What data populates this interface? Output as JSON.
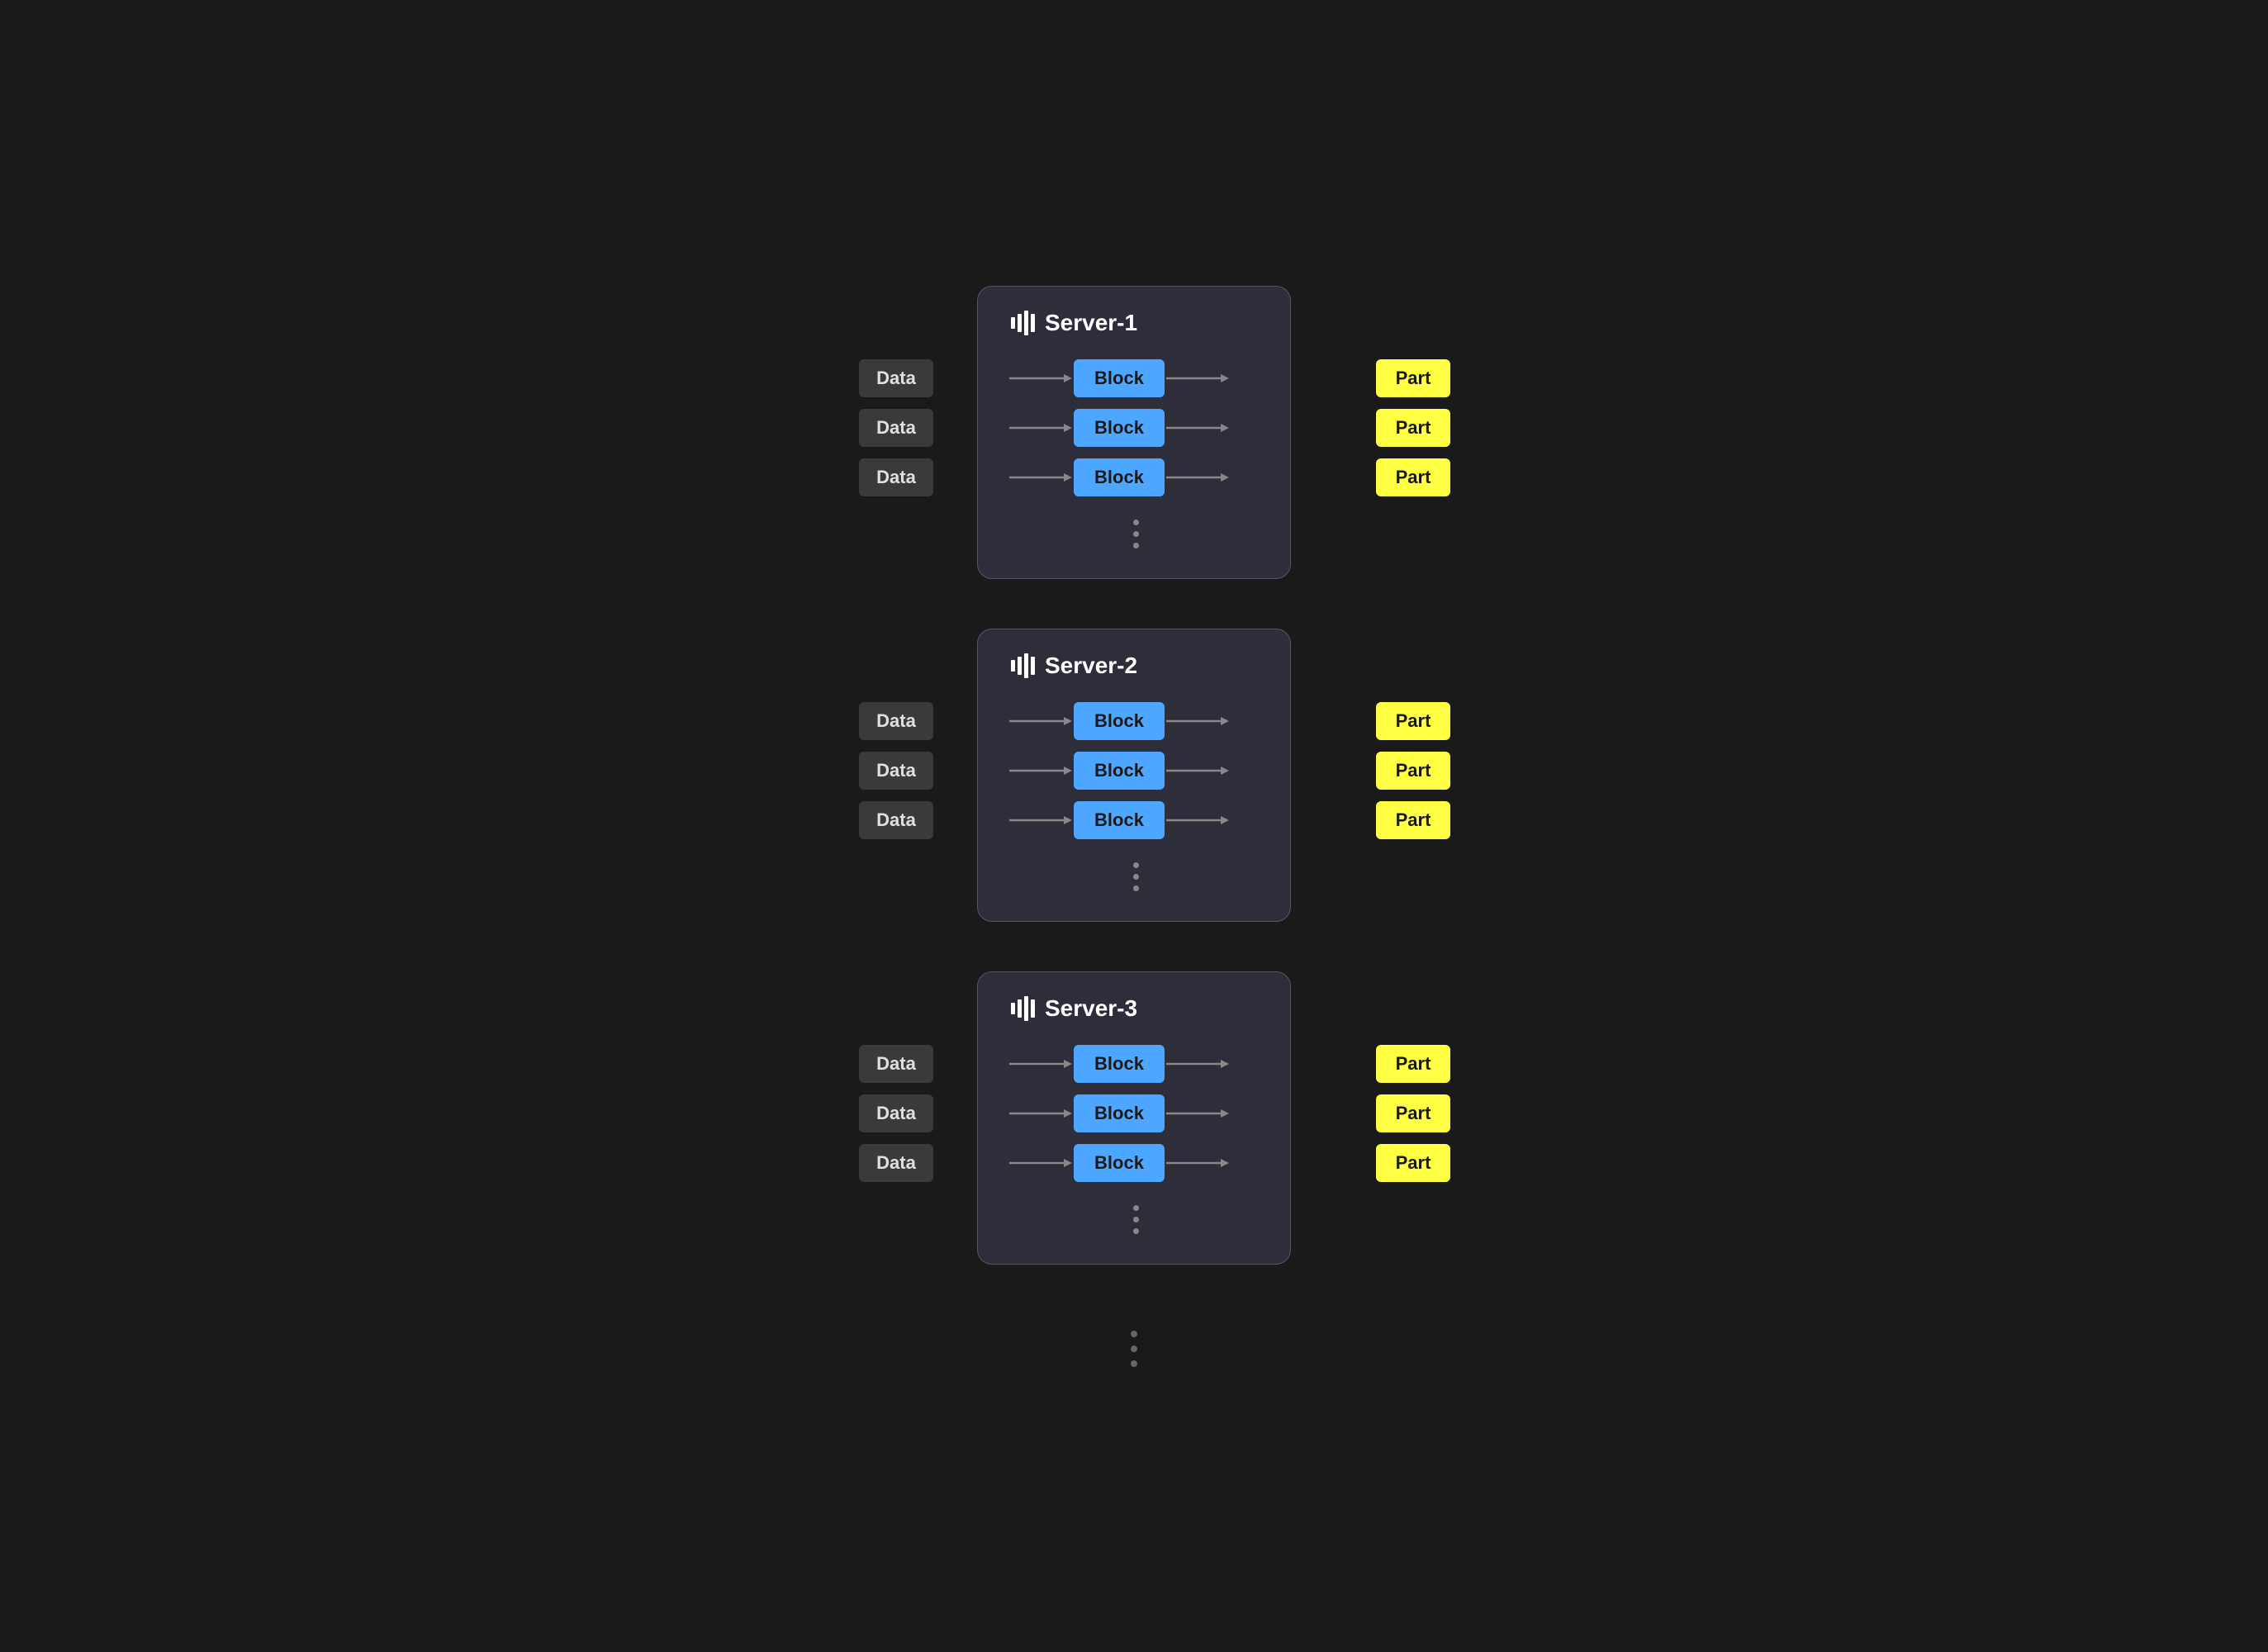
{
  "servers": [
    {
      "id": "server-1",
      "label": "Server-1",
      "rows": [
        {
          "data": "Data",
          "block": "Block",
          "part": "Part"
        },
        {
          "data": "Data",
          "block": "Block",
          "part": "Part"
        },
        {
          "data": "Data",
          "block": "Block",
          "part": "Part"
        }
      ]
    },
    {
      "id": "server-2",
      "label": "Server-2",
      "rows": [
        {
          "data": "Data",
          "block": "Block",
          "part": "Part"
        },
        {
          "data": "Data",
          "block": "Block",
          "part": "Part"
        },
        {
          "data": "Data",
          "block": "Block",
          "part": "Part"
        }
      ]
    },
    {
      "id": "server-3",
      "label": "Server-3",
      "rows": [
        {
          "data": "Data",
          "block": "Block",
          "part": "Part"
        },
        {
          "data": "Data",
          "block": "Block",
          "part": "Part"
        },
        {
          "data": "Data",
          "block": "Block",
          "part": "Part"
        }
      ]
    }
  ],
  "colors": {
    "background": "#1a1a1a",
    "server_bg": "#2e2e3a",
    "server_border": "#555566",
    "data_box_bg": "#3a3a3a",
    "data_box_text": "#e0e0e0",
    "block_box_bg": "#4da6ff",
    "block_box_text": "#1a1a1a",
    "part_box_bg": "#ffff44",
    "part_box_text": "#1a1a1a",
    "arrow_color": "#888888",
    "dot_color": "#888888"
  }
}
